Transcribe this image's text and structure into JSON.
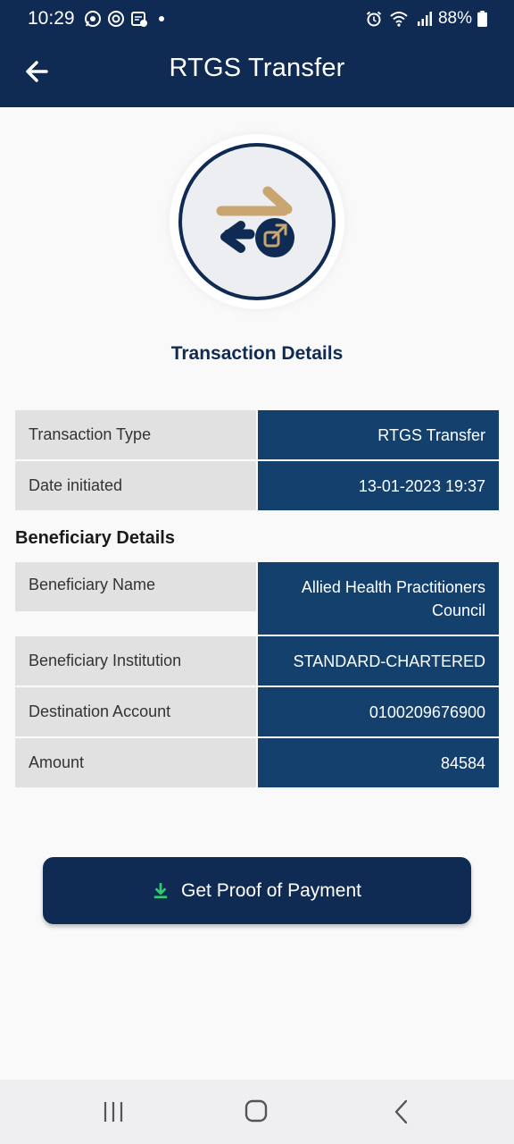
{
  "status_bar": {
    "time": "10:29",
    "battery": "88%",
    "left_icons": [
      "whatsapp-icon",
      "sync-icon",
      "calendar-app-icon",
      "dot"
    ],
    "right_icons": [
      "alarm-icon",
      "wifi-icon",
      "signal-icon",
      "battery-icon"
    ]
  },
  "app_bar": {
    "title": "RTGS Transfer",
    "back_icon": "arrow-left-icon"
  },
  "hero": {
    "icon": "transfer-arrows-icon"
  },
  "transaction": {
    "heading": "Transaction Details",
    "rows": [
      {
        "label": "Transaction Type",
        "value": "RTGS Transfer"
      },
      {
        "label": "Date initiated",
        "value": "13-01-2023 19:37"
      }
    ]
  },
  "beneficiary": {
    "heading": "Beneficiary Details",
    "rows": [
      {
        "label": "Beneficiary Name",
        "value": "Allied Health Practitioners Council"
      },
      {
        "label": "Beneficiary Institution",
        "value": "STANDARD-CHARTERED"
      },
      {
        "label": "Destination Account",
        "value": "0100209676900"
      },
      {
        "label": "Amount",
        "value": "84584"
      }
    ]
  },
  "action": {
    "label": "Get Proof of Payment",
    "icon": "download-icon"
  },
  "nav_bar": {
    "icons": [
      "recent-apps-icon",
      "home-icon",
      "back-icon"
    ]
  },
  "colors": {
    "primary": "#0f2a53",
    "value_cell": "#14406d",
    "label_cell": "#e1e1e1",
    "accent_gold": "#c9a670",
    "download_green": "#2ecc71"
  }
}
